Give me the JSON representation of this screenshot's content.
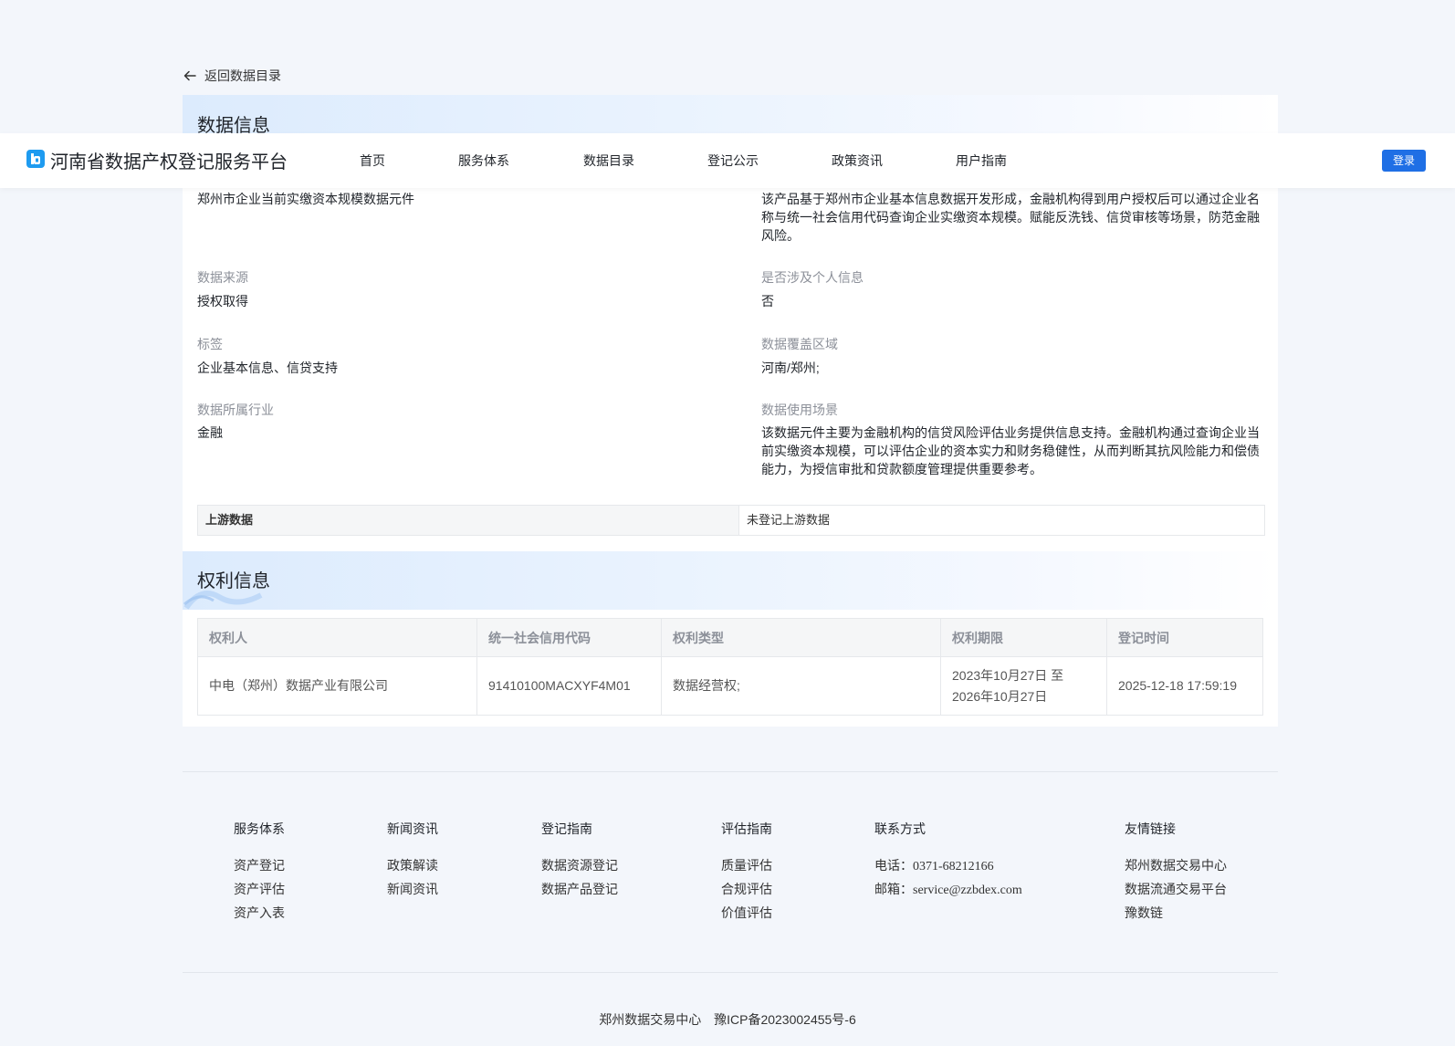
{
  "header": {
    "brand": "河南省数据产权登记服务平台",
    "nav": [
      "首页",
      "服务体系",
      "数据目录",
      "登记公示",
      "政策资讯",
      "用户指南"
    ],
    "login": "登录"
  },
  "back_link": "返回数据目录",
  "data_info": {
    "title": "数据信息",
    "name_value": "郑州市企业当前实缴资本规模数据元件",
    "description_value": "该产品基于郑州市企业基本信息数据开发形成，金融机构得到用户授权后可以通过企业名称与统一社会信用代码查询企业实缴资本规模。赋能反洗钱、信贷审核等场景，防范金融风险。",
    "fields": [
      {
        "label": "数据来源",
        "value": "授权取得"
      },
      {
        "label": "是否涉及个人信息",
        "value": "否"
      },
      {
        "label": "标签",
        "value": "企业基本信息、信贷支持"
      },
      {
        "label": "数据覆盖区域",
        "value": "河南/郑州;"
      },
      {
        "label": "数据所属行业",
        "value": "金融"
      },
      {
        "label": "数据使用场景",
        "value": "该数据元件主要为金融机构的信贷风险评估业务提供信息支持。金融机构通过查询企业当前实缴资本规模，可以评估企业的资本实力和财务稳健性，从而判断其抗风险能力和偿债能力，为授信审批和贷款额度管理提供重要参考。"
      }
    ],
    "upstream_label": "上游数据",
    "upstream_value": "未登记上游数据"
  },
  "rights_info": {
    "title": "权利信息",
    "columns": [
      "权利人",
      "统一社会信用代码",
      "权利类型",
      "权利期限",
      "登记时间"
    ],
    "rows": [
      {
        "holder": "中电（郑州）数据产业有限公司",
        "credit_code": "91410100MACXYF4M01",
        "right_type": "数据经营权;",
        "term_line1": "2023年10月27日 至",
        "term_line2": "2026年10月27日",
        "registered_at": "2025-12-18 17:59:19"
      }
    ]
  },
  "footer": {
    "columns": [
      {
        "title": "服务体系",
        "links": [
          "资产登记",
          "资产评估",
          "资产入表"
        ]
      },
      {
        "title": "新闻资讯",
        "links": [
          "政策解读",
          "新闻资讯"
        ]
      },
      {
        "title": "登记指南",
        "links": [
          "数据资源登记",
          "数据产品登记"
        ]
      },
      {
        "title": "评估指南",
        "links": [
          "质量评估",
          "合规评估",
          "价值评估"
        ]
      },
      {
        "title": "联系方式",
        "phone_label": "电话：",
        "phone": "0371-68212166",
        "email_label": "邮箱：",
        "email": "service@zzbdex.com"
      },
      {
        "title": "友情链接",
        "links": [
          "郑州数据交易中心",
          "数据流通交易平台",
          "豫数链"
        ]
      }
    ],
    "org": "郑州数据交易中心",
    "icp": "豫ICP备2023002455号-6"
  }
}
